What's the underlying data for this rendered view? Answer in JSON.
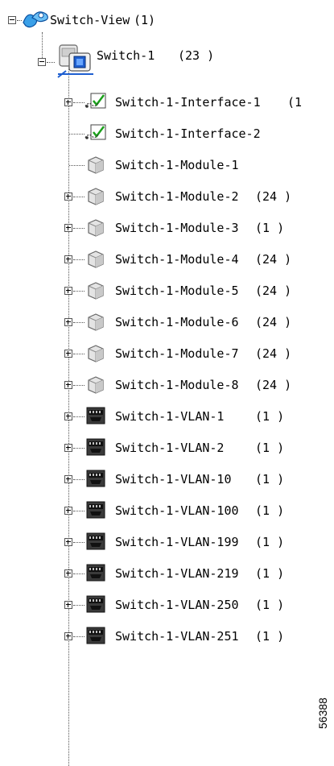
{
  "root": {
    "label": "Switch-View",
    "count": "(1)"
  },
  "switch": {
    "label": "Switch-1",
    "count": "(23 )"
  },
  "items": [
    {
      "label": "Switch-1-Interface-1",
      "count": "(1",
      "icon": "interface-check-icon",
      "expandable": true
    },
    {
      "label": "Switch-1-Interface-2",
      "count": "",
      "icon": "interface-check-icon",
      "expandable": false
    },
    {
      "label": "Switch-1-Module-1",
      "count": "",
      "icon": "module-cube-icon",
      "expandable": false
    },
    {
      "label": "Switch-1-Module-2",
      "count": "(24 )",
      "icon": "module-cube-icon",
      "expandable": true
    },
    {
      "label": "Switch-1-Module-3",
      "count": "(1 )",
      "icon": "module-cube-icon",
      "expandable": true
    },
    {
      "label": "Switch-1-Module-4",
      "count": "(24 )",
      "icon": "module-cube-icon",
      "expandable": true
    },
    {
      "label": "Switch-1-Module-5",
      "count": "(24 )",
      "icon": "module-cube-icon",
      "expandable": true
    },
    {
      "label": "Switch-1-Module-6",
      "count": "(24 )",
      "icon": "module-cube-icon",
      "expandable": true
    },
    {
      "label": "Switch-1-Module-7",
      "count": "(24 )",
      "icon": "module-cube-icon",
      "expandable": true
    },
    {
      "label": "Switch-1-Module-8",
      "count": "(24 )",
      "icon": "module-cube-icon",
      "expandable": true
    },
    {
      "label": "Switch-1-VLAN-1",
      "count": "(1 )",
      "icon": "vlan-port-icon",
      "expandable": true
    },
    {
      "label": "Switch-1-VLAN-2",
      "count": "(1 )",
      "icon": "vlan-port-icon",
      "expandable": true
    },
    {
      "label": "Switch-1-VLAN-10",
      "count": "(1 )",
      "icon": "vlan-port-icon",
      "expandable": true
    },
    {
      "label": "Switch-1-VLAN-100",
      "count": "(1 )",
      "icon": "vlan-port-icon",
      "expandable": true
    },
    {
      "label": "Switch-1-VLAN-199",
      "count": "(1 )",
      "icon": "vlan-port-icon",
      "expandable": true
    },
    {
      "label": "Switch-1-VLAN-219",
      "count": "(1 )",
      "icon": "vlan-port-icon",
      "expandable": true
    },
    {
      "label": "Switch-1-VLAN-250",
      "count": "(1 )",
      "icon": "vlan-port-icon",
      "expandable": true
    },
    {
      "label": "Switch-1-VLAN-251",
      "count": "(1 )",
      "icon": "vlan-port-icon",
      "expandable": true
    }
  ],
  "figure_number": "56388",
  "colors": {
    "accent": "#0a5fd6",
    "line": "#555555"
  }
}
